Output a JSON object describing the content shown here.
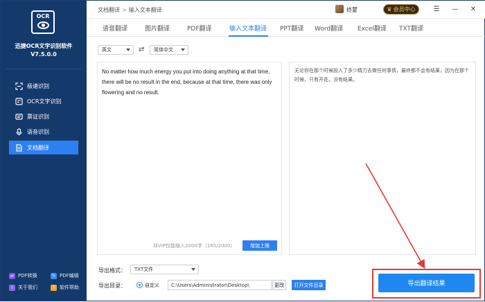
{
  "sidebar": {
    "logo_text": "OCR",
    "app_name": "迅捷OCR文字识别软件",
    "version": "V7.5.0.0",
    "items": [
      {
        "label": "极速识别",
        "icon": "scan-icon"
      },
      {
        "label": "OCR文字识别",
        "icon": "ocr-icon"
      },
      {
        "label": "票证识别",
        "icon": "ticket-icon"
      },
      {
        "label": "语音识别",
        "icon": "microphone-icon"
      },
      {
        "label": "文档翻译",
        "icon": "document-icon"
      }
    ],
    "active_index": 4,
    "footer": [
      {
        "label": "PDF转换",
        "icon": "pdf-convert-icon"
      },
      {
        "label": "PDF编辑",
        "icon": "pdf-edit-icon"
      },
      {
        "label": "关于我们",
        "icon": "info-icon"
      },
      {
        "label": "软件帮助",
        "icon": "help-icon"
      }
    ]
  },
  "header": {
    "breadcrumb": [
      "文档翻译",
      "输入文本翻译"
    ],
    "username": "终蒙",
    "vip_label": "会员中心"
  },
  "tabs": {
    "items": [
      "语音翻译",
      "图片翻译",
      "PDF翻译",
      "输入文本翻译",
      "PPT翻译",
      "Word翻译",
      "Excel翻译",
      "TXT翻译"
    ],
    "active_index": 3
  },
  "language": {
    "source": "英文",
    "target": "简体中文"
  },
  "source_text": "No matter how much energy you put into doing anything at that time, there will be no result in the end, because at that time, there was only flowering and no result.",
  "translated_text": "无论你在那个时候投入了多少精力去做任何事情，最终都不会有结果，因为在那个时候，只有开花，没有结果。",
  "char_count_text": "非VIP仅能输入2000字（165/2000）",
  "raise_limit_label": "增加上限",
  "export": {
    "format_label": "导出格式：",
    "format_value": "TXT文件",
    "dir_label": "导出目录：",
    "dir_option": "自定义",
    "dir_path": "C:\\Users\\Administrator\\Desktop\\",
    "change_label": "更改",
    "open_dir_label": "打开文件目录",
    "export_button": "导出翻译结果"
  },
  "colors": {
    "sidebar_bg": "#143a6b",
    "accent": "#2e7ff1",
    "highlight_box": "#e53935"
  }
}
